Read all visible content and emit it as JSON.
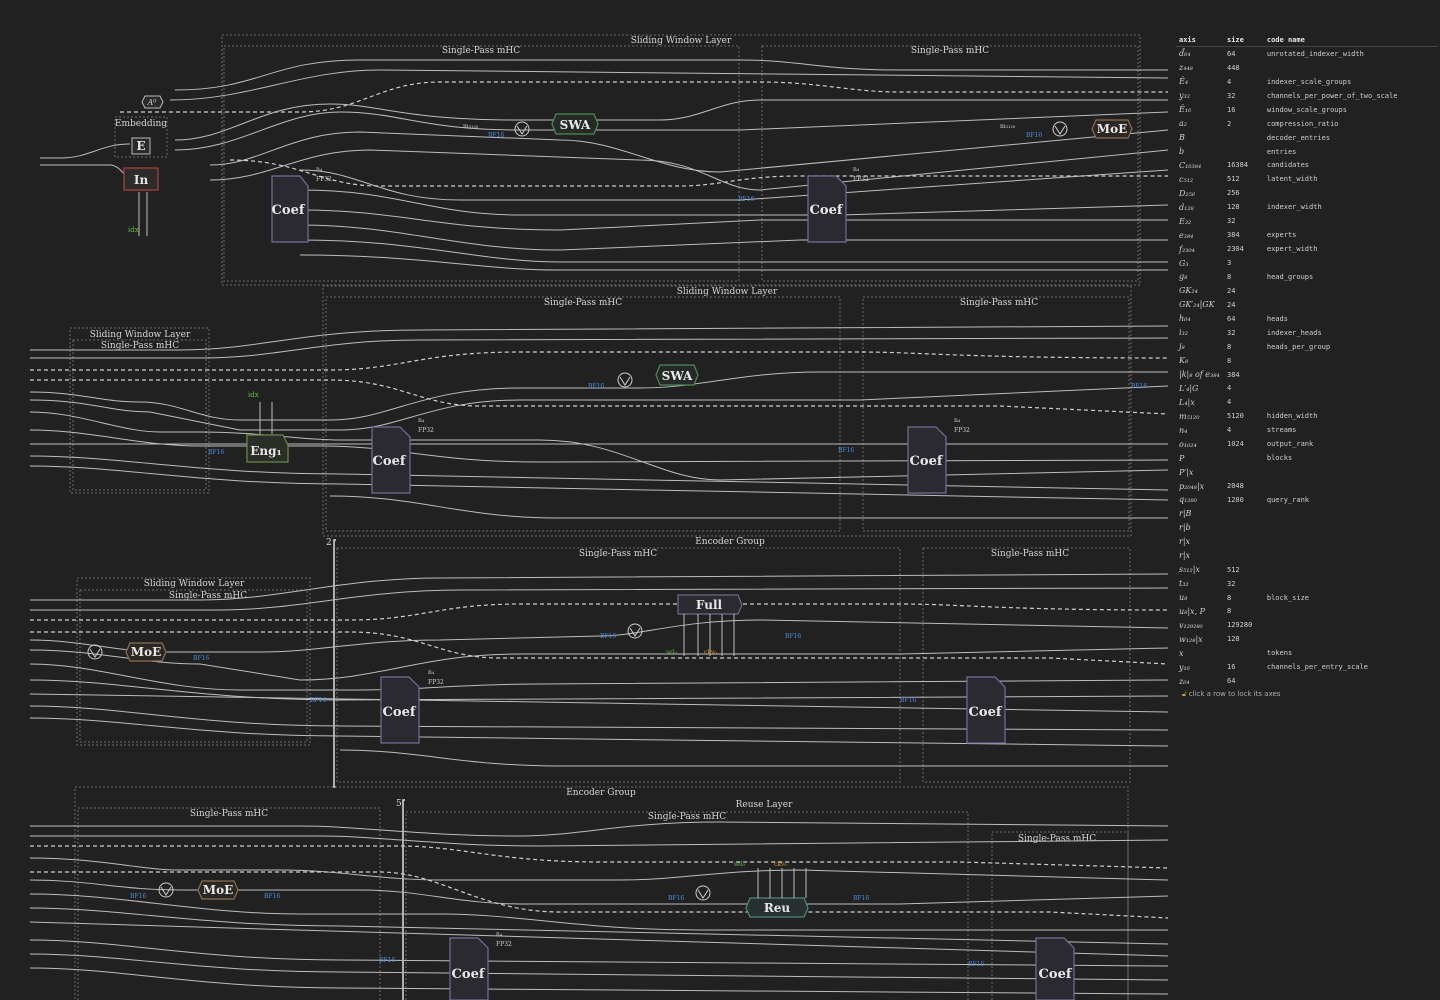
{
  "diagram": {
    "row1": {
      "outer": "Sliding Window Layer",
      "mhc_a": "Single-Pass mHC",
      "mhc_b": "Single-Pass mHC",
      "embedding": "Embedding",
      "nodes": {
        "a0": "A⁰",
        "e": "E",
        "in": "In",
        "coef_a": "Coef",
        "coef_b": "Coef",
        "swa": "SWA",
        "moe": "MoE"
      },
      "idx": "idx"
    },
    "row2": {
      "left_outer": "Sliding Window Layer",
      "left_mhc": "Single-Pass mHC",
      "outer": "Sliding Window Layer",
      "mhc_a": "Single-Pass mHC",
      "mhc_b": "Single-Pass mHC",
      "nodes": {
        "eng": "Eng₁",
        "coef_a": "Coef",
        "coef_b": "Coef",
        "swa": "SWA"
      },
      "idx": "idx"
    },
    "row3": {
      "left_outer": "Sliding Window Layer",
      "left_mhc": "Single-Pass mHC",
      "outer": "Encoder Group",
      "repeat": "2",
      "mhc_a": "Single-Pass mHC",
      "mhc_b": "Single-Pass mHC",
      "nodes": {
        "moe": "MoE",
        "coef_a": "Coef",
        "coef_b": "Coef",
        "full": "Full"
      },
      "sel": "sel₀",
      "ckv": "ckv₀"
    },
    "row4": {
      "outer": "Encoder Group",
      "left_mhc": "Single-Pass mHC",
      "reuse": "Reuse Layer",
      "repeat": "5",
      "mhc_a": "Single-Pass mHC",
      "mhc_b": "Single-Pass mHC",
      "nodes": {
        "moe": "MoE",
        "coef_a": "Coef",
        "coef_b": "Coef",
        "reu": "Reu"
      },
      "sel": "sel₀",
      "ckv": "ckv₀"
    },
    "wire_labels": {
      "x": "x",
      "n4": "n₄",
      "m5120": "m₅₁₂₀",
      "fp32": "FP32",
      "bf16": "BF16"
    }
  },
  "legend": {
    "headers": {
      "axis": "axis",
      "size": "size",
      "code": "code name"
    },
    "rows": [
      {
        "axis": "d̂₆₄",
        "size": "64",
        "code": "unrotated_indexer_width"
      },
      {
        "axis": "z₄₄₈",
        "size": "448",
        "code": ""
      },
      {
        "axis": "Ê₄",
        "size": "4",
        "code": "indexer_scale_groups"
      },
      {
        "axis": "y₃₂",
        "size": "32",
        "code": "channels_per_power_of_two_scale"
      },
      {
        "axis": "Ê₁₆",
        "size": "16",
        "code": "window_scale_groups"
      },
      {
        "axis": "a₂",
        "size": "2",
        "code": "compression_ratio"
      },
      {
        "axis": "B",
        "size": "",
        "code": "decoder_entries"
      },
      {
        "axis": "b",
        "size": "",
        "code": "entries"
      },
      {
        "axis": "C₁₆₃₈₄",
        "size": "16384",
        "code": "candidates"
      },
      {
        "axis": "c₅₁₂",
        "size": "512",
        "code": "latent_width"
      },
      {
        "axis": "D₂₅₆",
        "size": "256",
        "code": ""
      },
      {
        "axis": "d₁₂₈",
        "size": "128",
        "code": "indexer_width"
      },
      {
        "axis": "E₃₂",
        "size": "32",
        "code": ""
      },
      {
        "axis": "e₃₈₄",
        "size": "384",
        "code": "experts"
      },
      {
        "axis": "f₂₃₀₄",
        "size": "2304",
        "code": "expert_width"
      },
      {
        "axis": "G₃",
        "size": "3",
        "code": ""
      },
      {
        "axis": "g₈",
        "size": "8",
        "code": "head_groups"
      },
      {
        "axis": "GK₂₄",
        "size": "24",
        "code": ""
      },
      {
        "axis": "GK′₂₄|GK",
        "size": "24",
        "code": ""
      },
      {
        "axis": "h₆₄",
        "size": "64",
        "code": "heads"
      },
      {
        "axis": "i₃₂",
        "size": "32",
        "code": "indexer_heads"
      },
      {
        "axis": "j₈",
        "size": "8",
        "code": "heads_per_group"
      },
      {
        "axis": "K₈",
        "size": "8",
        "code": ""
      },
      {
        "axis": "|k|₈ of e₃₈₄",
        "size": "384",
        "code": ""
      },
      {
        "axis": "L′₄|G",
        "size": "4",
        "code": ""
      },
      {
        "axis": "L₄|x",
        "size": "4",
        "code": ""
      },
      {
        "axis": "m₅₁₂₀",
        "size": "5120",
        "code": "hidden_width"
      },
      {
        "axis": "n₄",
        "size": "4",
        "code": "streams"
      },
      {
        "axis": "o₁₀₂₄",
        "size": "1024",
        "code": "output_rank"
      },
      {
        "axis": "P",
        "size": "",
        "code": "blocks"
      },
      {
        "axis": "P′|x",
        "size": "",
        "code": ""
      },
      {
        "axis": "p₂₀₄₈|x",
        "size": "2048",
        "code": ""
      },
      {
        "axis": "q₁₂₈₀",
        "size": "1280",
        "code": "query_rank"
      },
      {
        "axis": "r|B",
        "size": "",
        "code": ""
      },
      {
        "axis": "r|b",
        "size": "",
        "code": ""
      },
      {
        "axis": "r|x",
        "size": "",
        "code": ""
      },
      {
        "axis": "r|x",
        "size": "",
        "code": ""
      },
      {
        "axis": "s₅₁₂|x",
        "size": "512",
        "code": ""
      },
      {
        "axis": "t₃₂",
        "size": "32",
        "code": ""
      },
      {
        "axis": "u₈",
        "size": "8",
        "code": "block_size"
      },
      {
        "axis": "u₈|x, P",
        "size": "8",
        "code": ""
      },
      {
        "axis": "v₁₂₉₂₈₀",
        "size": "129280",
        "code": ""
      },
      {
        "axis": "w₁₂₈|x",
        "size": "128",
        "code": ""
      },
      {
        "axis": "x",
        "size": "",
        "code": "tokens"
      },
      {
        "axis": "y₁₆",
        "size": "16",
        "code": "channels_per_entry_scale"
      },
      {
        "axis": "z₆₄",
        "size": "64",
        "code": ""
      }
    ],
    "hint": "click a row to lock its axes",
    "colors": {
      "accent_blue": "#4a8fe0",
      "idx_green": "#5fbf3f",
      "ckv_orange": "#e0902a",
      "coef_border": "#7b6a9c",
      "node_border": "#4c8a5a"
    }
  }
}
